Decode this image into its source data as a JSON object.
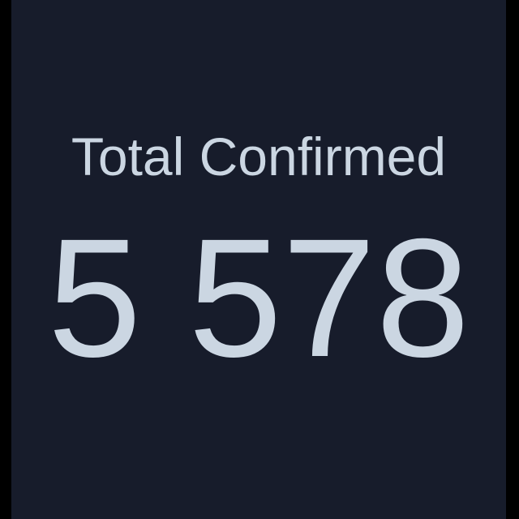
{
  "stat_card": {
    "title": "Total Confirmed",
    "value": "5 578"
  },
  "colors": {
    "background": "#000000",
    "card": "#171c2b",
    "text": "#cbd6e2"
  }
}
